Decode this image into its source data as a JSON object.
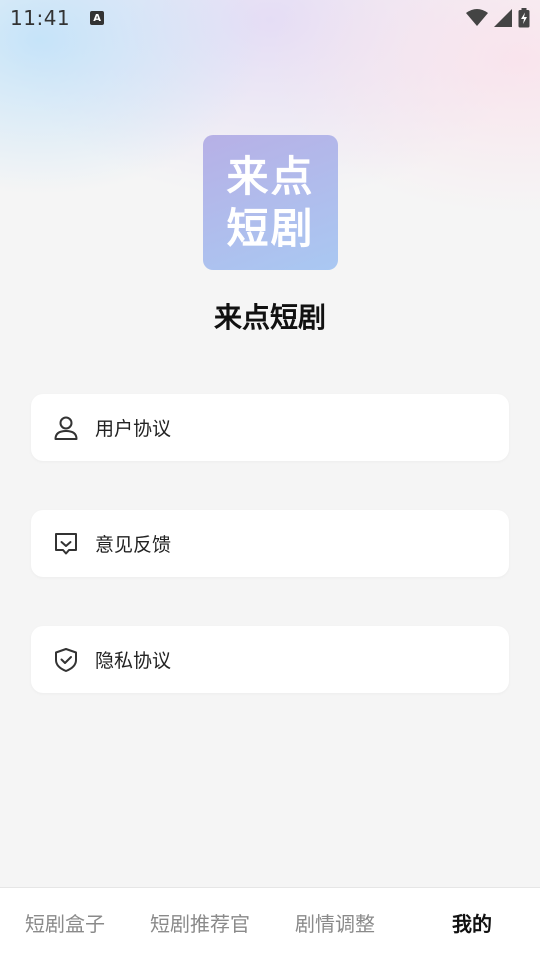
{
  "status_bar": {
    "time": "11:41",
    "app_indicator": "A"
  },
  "logo": {
    "line1": "来点",
    "line2": "短剧",
    "gradient_from": "#b7b0e6",
    "gradient_to": "#a9c8f2"
  },
  "app_title": "来点短剧",
  "menu": {
    "items": [
      {
        "label": "用户协议",
        "icon": "person-icon"
      },
      {
        "label": "意见反馈",
        "icon": "feedback-icon"
      },
      {
        "label": "隐私协议",
        "icon": "shield-check-icon"
      }
    ]
  },
  "bottom_nav": {
    "tabs": [
      {
        "label": "短剧盒子",
        "active": false
      },
      {
        "label": "短剧推荐官",
        "active": false
      },
      {
        "label": "剧情调整",
        "active": false
      },
      {
        "label": "我的",
        "active": true
      }
    ]
  }
}
